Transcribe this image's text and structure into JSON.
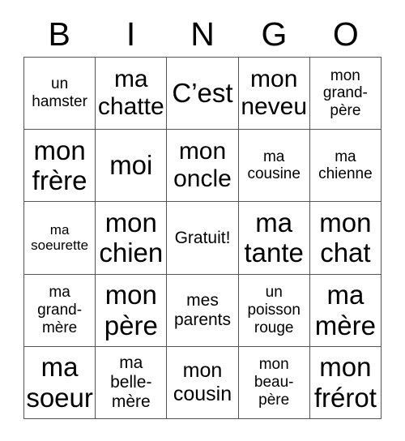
{
  "card": {
    "header": {
      "letters": [
        "B",
        "I",
        "N",
        "G",
        "O"
      ]
    },
    "colors": {
      "background": "#ffffff",
      "text": "#000000",
      "grid_line": "#555555"
    },
    "rows": [
      [
        {
          "text": "un\nhamster",
          "size": "fs-sm"
        },
        {
          "text": "ma\nchatte",
          "size": "fs-xl"
        },
        {
          "text": "C’est",
          "size": "fs-xxl"
        },
        {
          "text": "mon\nneveu",
          "size": "fs-xl"
        },
        {
          "text": "mon\ngrand-\npère",
          "size": "fs-sm"
        }
      ],
      [
        {
          "text": "mon\nfrère",
          "size": "fs-xxl"
        },
        {
          "text": "moi",
          "size": "fs-xxl"
        },
        {
          "text": "mon\noncle",
          "size": "fs-xl"
        },
        {
          "text": "ma\ncousine",
          "size": "fs-sm"
        },
        {
          "text": "ma\nchienne",
          "size": "fs-sm"
        }
      ],
      [
        {
          "text": "ma\nsoeurette",
          "size": "fs-xs"
        },
        {
          "text": "mon\nchien",
          "size": "fs-xxl"
        },
        {
          "text": "Gratuit!",
          "size": "fs-md"
        },
        {
          "text": "ma\ntante",
          "size": "fs-xxl"
        },
        {
          "text": "mon\nchat",
          "size": "fs-xxl"
        }
      ],
      [
        {
          "text": "ma\ngrand-\nmère",
          "size": "fs-sm"
        },
        {
          "text": "mon\npère",
          "size": "fs-xxl"
        },
        {
          "text": "mes\nparents",
          "size": "fs-md"
        },
        {
          "text": "un\npoisson\nrouge",
          "size": "fs-sm"
        },
        {
          "text": "ma\nmère",
          "size": "fs-xxl"
        }
      ],
      [
        {
          "text": "ma\nsoeur",
          "size": "fs-xxl"
        },
        {
          "text": "ma\nbelle-\nmère",
          "size": "fs-md"
        },
        {
          "text": "mon\ncousin",
          "size": "fs-lg"
        },
        {
          "text": "mon\nbeau-\npère",
          "size": "fs-sm"
        },
        {
          "text": "mon\nfrérot",
          "size": "fs-xxl"
        }
      ]
    ]
  }
}
